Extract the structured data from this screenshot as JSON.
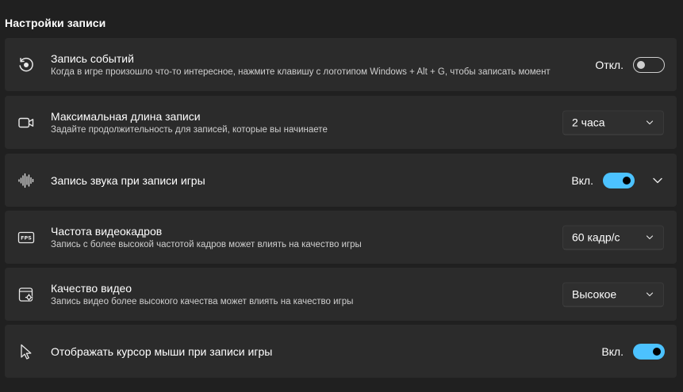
{
  "section": {
    "title": "Настройки записи"
  },
  "rows": [
    {
      "icon": "record-event-icon",
      "title": "Запись событий",
      "subtitle": "Когда в игре произошло что-то интересное, нажмите клавишу с логотипом Windows + Alt + G, чтобы записать момент",
      "control": {
        "type": "toggle",
        "label": "Откл.",
        "state": "off"
      }
    },
    {
      "icon": "video-camera-icon",
      "title": "Максимальная длина записи",
      "subtitle": "Задайте продолжительность для записей, которые вы начинаете",
      "control": {
        "type": "dropdown",
        "value": "2 часа"
      }
    },
    {
      "icon": "audio-wave-icon",
      "title": "Запись звука при записи игры",
      "subtitle": "",
      "control": {
        "type": "toggle",
        "label": "Вкл.",
        "state": "on",
        "expandable": true
      }
    },
    {
      "icon": "fps-icon",
      "title": "Частота видеокадров",
      "subtitle": "Запись с более высокой частотой кадров может влиять на качество игры",
      "control": {
        "type": "dropdown",
        "value": "60 кадр/с"
      }
    },
    {
      "icon": "video-quality-icon",
      "title": "Качество видео",
      "subtitle": "Запись видео более высокого качества может влиять на качество игры",
      "control": {
        "type": "dropdown",
        "value": "Высокое"
      }
    },
    {
      "icon": "mouse-cursor-icon",
      "title": "Отображать курсор мыши при записи игры",
      "subtitle": "",
      "control": {
        "type": "toggle",
        "label": "Вкл.",
        "state": "on"
      }
    }
  ],
  "colors": {
    "background": "#202020",
    "card": "#2b2b2b",
    "accent": "#4cc2ff"
  }
}
